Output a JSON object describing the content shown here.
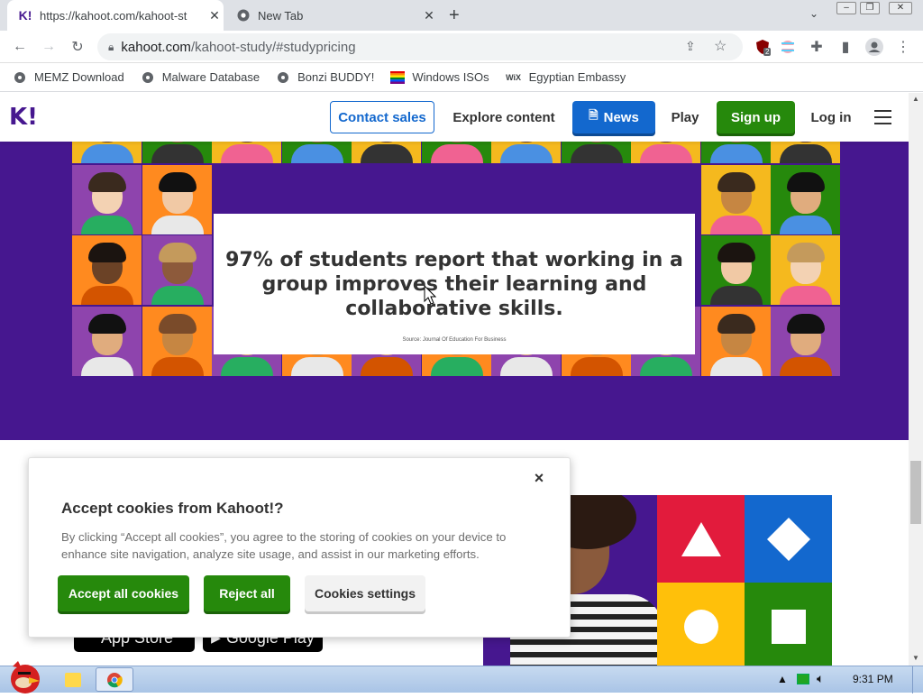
{
  "browser": {
    "tabs": [
      {
        "title": "https://kahoot.com/kahoot-st",
        "favicon": "K!"
      },
      {
        "title": "New Tab",
        "favicon": "chrome-icon"
      }
    ],
    "new_tab_symbol": "+",
    "url_host": "kahoot.com",
    "url_path": "/kahoot-study/#studypricing",
    "bookmarks": [
      {
        "label": "MEMZ Download",
        "icon": "globe-icon"
      },
      {
        "label": "Malware Database",
        "icon": "globe-icon"
      },
      {
        "label": "Bonzi BUDDY!",
        "icon": "globe-icon"
      },
      {
        "label": "Windows ISOs",
        "icon": "rainbow-flag-icon"
      },
      {
        "label": "Egyptian Embassy",
        "icon": "wix-icon"
      }
    ],
    "extension_badge": "2"
  },
  "site": {
    "logo": "K!",
    "nav": {
      "contact_sales": "Contact sales",
      "explore_content": "Explore content",
      "news": "News",
      "play": "Play",
      "sign_up": "Sign up",
      "log_in": "Log in"
    },
    "stat_text": "97% of students report that working in a group improves their learning and collaborative skills.",
    "stat_source": "Source: Journal Of Education For Business",
    "store_buttons": [
      "App Store",
      "Google Play"
    ]
  },
  "cookie_dialog": {
    "title": "Accept cookies from Kahoot!?",
    "body": "By clicking “Accept all cookies”, you agree to the storing of cookies on your device to enhance site navigation, analyze site usage, and assist in our marketing efforts.",
    "accept": "Accept all cookies",
    "reject": "Reject all",
    "settings": "Cookies settings",
    "close": "×"
  },
  "taskbar": {
    "time": "9:31 PM"
  },
  "colors": {
    "kahoot_purple": "#46178f",
    "contact_blue": "#1368ce",
    "signup_green": "#26890c",
    "shape_red": "#e21b3c",
    "shape_blue": "#1368ce",
    "shape_yellow": "#ffc00a",
    "shape_green": "#26890c"
  }
}
